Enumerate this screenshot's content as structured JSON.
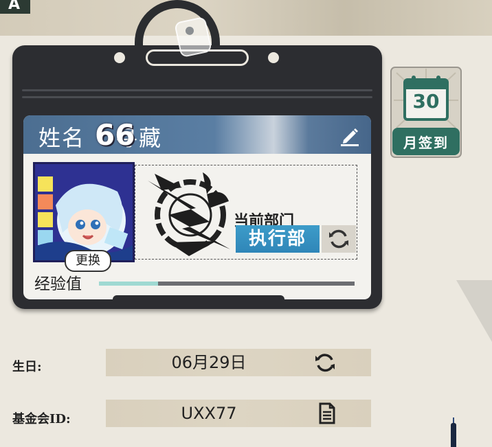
{
  "id_card": {
    "name_label": "姓名",
    "name_value": "寻藏",
    "level": "66",
    "change_avatar_label": "更换",
    "department_label": "当前部门",
    "department_name": "执行部",
    "exp_label": "经验值",
    "exp_progress": 0.23
  },
  "monthly_checkin": {
    "day": "30",
    "label": "月签到"
  },
  "profile": {
    "birthday_label": "生日:",
    "birthday_value": "06月29日",
    "foundation_id_label": "基金会ID:",
    "foundation_id_value": "UXX77"
  },
  "colors": {
    "card_header": "#4c6e91",
    "department_badge": "#2f86b8",
    "exp_fill": "#9fd9d2",
    "calendar_green": "#2f6f61",
    "holder": "#2c2d31"
  },
  "icons": [
    "edit-pencil-icon",
    "refresh-icon",
    "calendar-icon",
    "document-icon"
  ]
}
